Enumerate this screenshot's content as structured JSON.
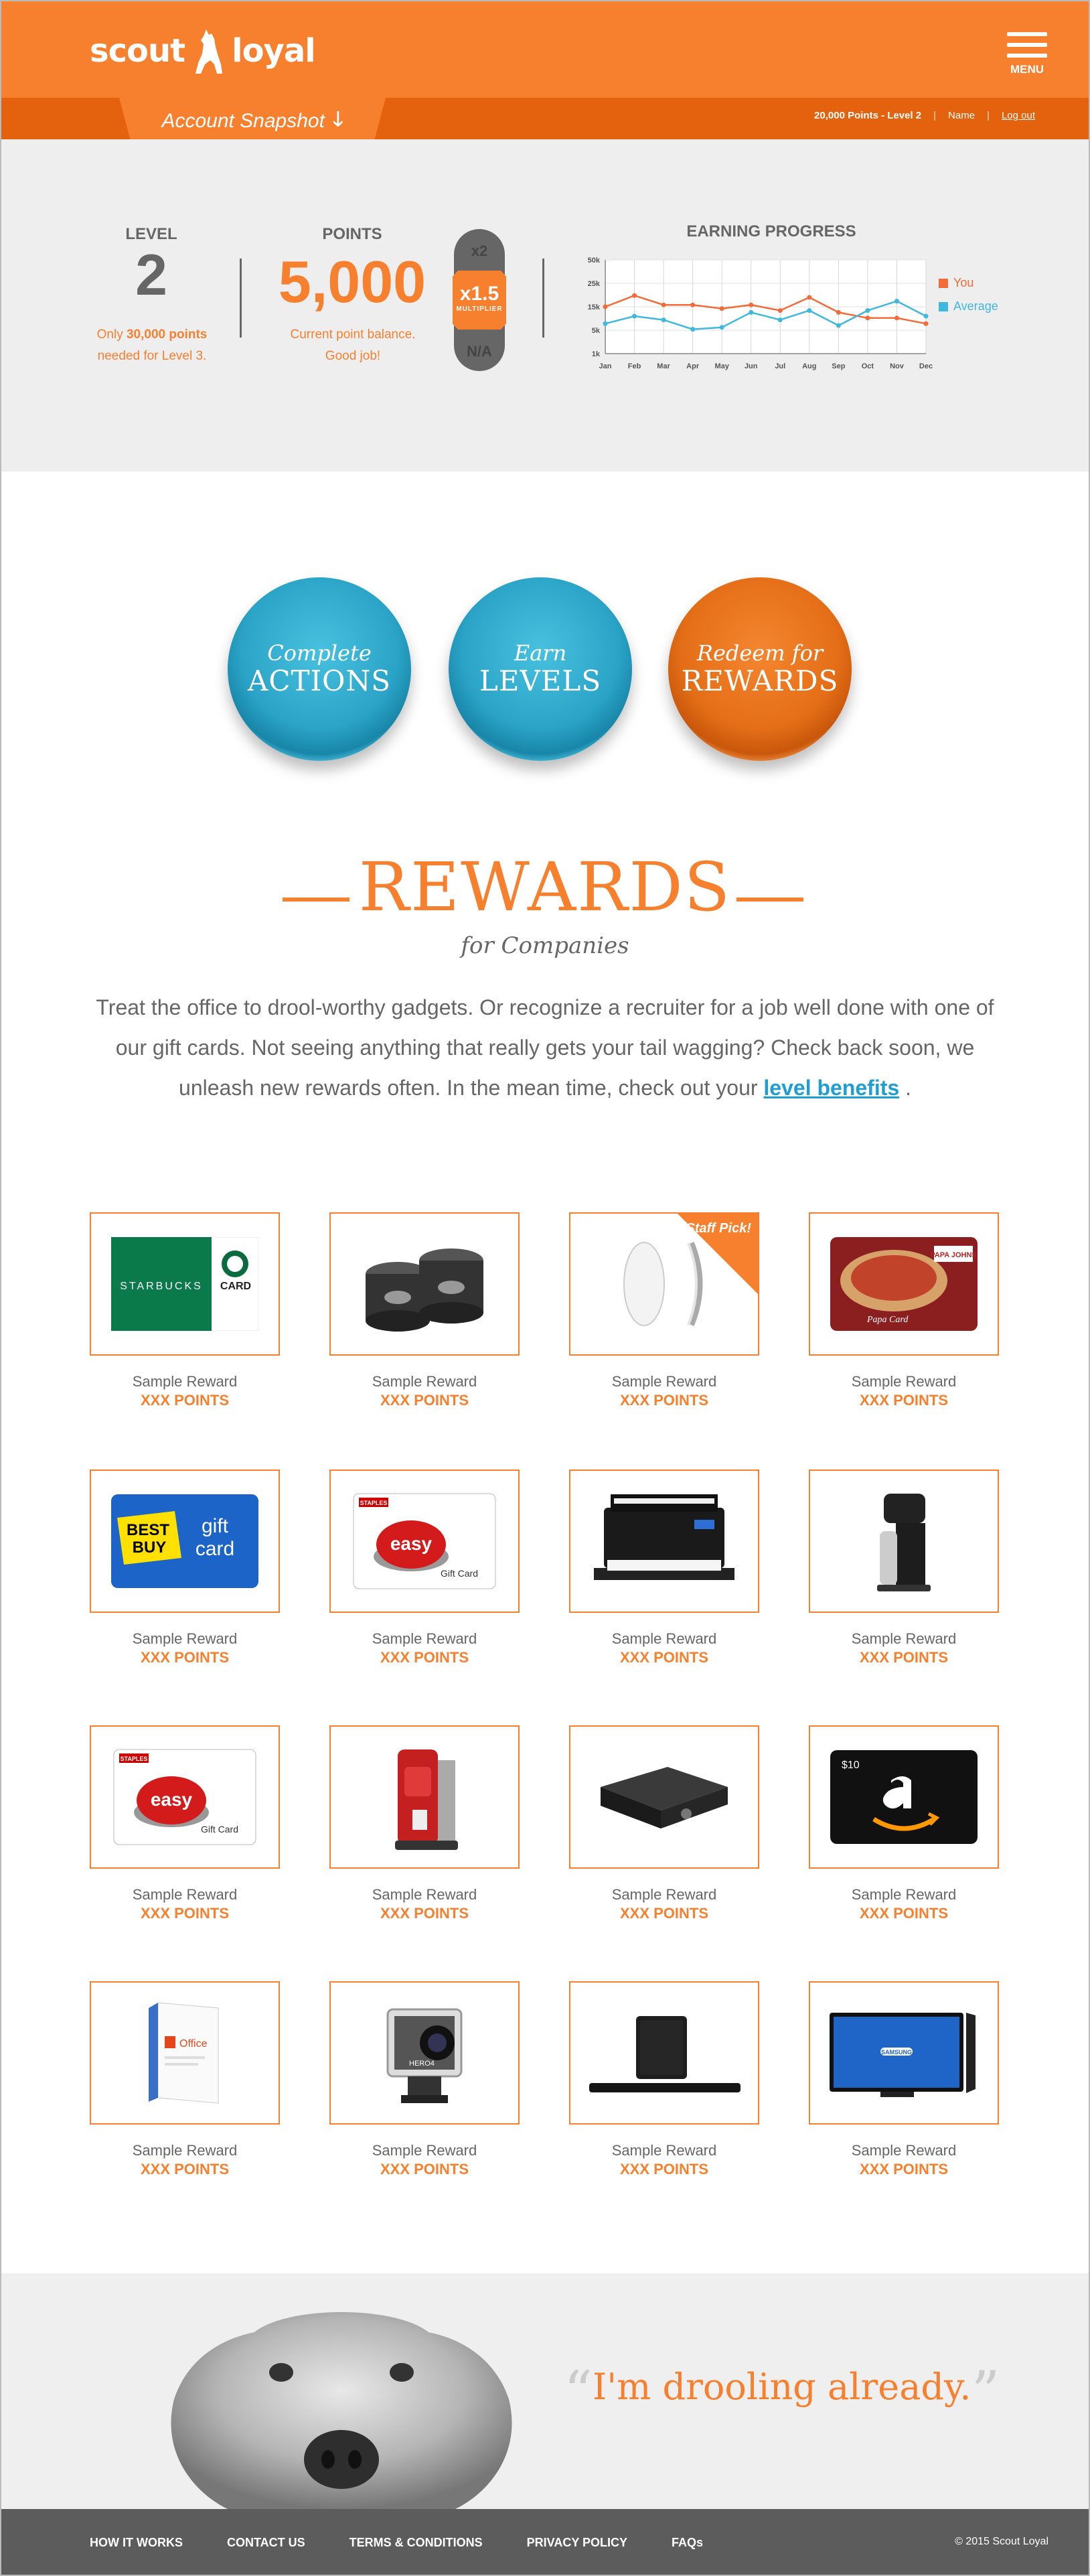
{
  "header": {
    "logo_left": "scout",
    "logo_right": "loyal",
    "menu_label": "MENU",
    "snapshot_label": "Account Snapshot",
    "snapshot_arrow": "🡓",
    "points_level": "20,000 Points - Level 2",
    "sep": "|",
    "name": "Name",
    "logout": "Log out"
  },
  "stats": {
    "level_label": "LEVEL",
    "level_value": "2",
    "level_note_pre": "Only ",
    "level_note_bold": "30,000 points",
    "level_note_post": "needed for Level 3.",
    "points_label": "POINTS",
    "points_value": "5,000",
    "points_note_1": "Current point balance.",
    "points_note_2": "Good job!",
    "mult_top": "x2",
    "mult_value": "x1.5",
    "mult_sub": "MULTIPLIER",
    "mult_bottom": "N/A",
    "chart_title": "EARNING PROGRESS",
    "legend_you": "You",
    "legend_avg": "Average"
  },
  "chart_data": {
    "type": "line",
    "title": "EARNING PROGRESS",
    "categories": [
      "Jan",
      "Feb",
      "Mar",
      "Apr",
      "May",
      "Jun",
      "Jul",
      "Aug",
      "Sep",
      "Oct",
      "Nov",
      "Dec"
    ],
    "y_ticks": [
      "50k",
      "25k",
      "15k",
      "5k",
      "1k"
    ],
    "ylim": [
      0,
      5
    ],
    "grid": true,
    "legend_position": "right",
    "series": [
      {
        "name": "You",
        "color": "#f26b38",
        "values": [
          2.5,
          3.1,
          2.6,
          2.6,
          2.4,
          2.6,
          2.3,
          3.0,
          2.2,
          1.9,
          1.9,
          1.6
        ]
      },
      {
        "name": "Average",
        "color": "#3fb8e0",
        "values": [
          1.6,
          2.0,
          1.8,
          1.3,
          1.4,
          2.2,
          1.8,
          2.3,
          1.5,
          2.3,
          2.8,
          2.0
        ]
      }
    ]
  },
  "actions": [
    {
      "top": "Complete",
      "big": "ACTIONS"
    },
    {
      "top": "Earn",
      "big": "LEVELS"
    },
    {
      "top": "Redeem for",
      "big": "REWARDS"
    }
  ],
  "rewards": {
    "title": "REWARDS",
    "subtitle": "for Companies",
    "desc": "Treat the office to drool-worthy gadgets. Or recognize a recruiter for a job well done with one of our gift cards. Not seeing anything that really gets your tail wagging? Check back soon, we unleash new rewards often. In the mean time, check out your ",
    "link": "level benefits",
    "desc_end": " ."
  },
  "items": [
    {
      "name": "Sample Reward",
      "points": "XXX POINTS",
      "kind": "starbucks"
    },
    {
      "name": "Sample Reward",
      "points": "XXX POINTS",
      "kind": "speakers"
    },
    {
      "name": "Sample Reward",
      "points": "XXX POINTS",
      "kind": "mouse",
      "staff": "Staff Pick!"
    },
    {
      "name": "Sample Reward",
      "points": "XXX POINTS",
      "kind": "papajohns"
    },
    {
      "name": "Sample Reward",
      "points": "XXX POINTS",
      "kind": "bestbuy"
    },
    {
      "name": "Sample Reward",
      "points": "XXX POINTS",
      "kind": "staples"
    },
    {
      "name": "Sample Reward",
      "points": "XXX POINTS",
      "kind": "printer"
    },
    {
      "name": "Sample Reward",
      "points": "XXX POINTS",
      "kind": "sodastream"
    },
    {
      "name": "Sample Reward",
      "points": "XXX POINTS",
      "kind": "staples"
    },
    {
      "name": "Sample Reward",
      "points": "XXX POINTS",
      "kind": "coffee"
    },
    {
      "name": "Sample Reward",
      "points": "XXX POINTS",
      "kind": "projector"
    },
    {
      "name": "Sample Reward",
      "points": "XXX POINTS",
      "kind": "amazon"
    },
    {
      "name": "Sample Reward",
      "points": "XXX POINTS",
      "kind": "office"
    },
    {
      "name": "Sample Reward",
      "points": "XXX POINTS",
      "kind": "gopro"
    },
    {
      "name": "Sample Reward",
      "points": "XXX POINTS",
      "kind": "soundbar"
    },
    {
      "name": "Sample Reward",
      "points": "XXX POINTS",
      "kind": "tv"
    }
  ],
  "image_text": {
    "starbucks": "STARBUCKS",
    "card": "CARD",
    "papa": "PAPA JOHNS",
    "papa_card": "Papa Card",
    "best": "BEST",
    "buy": "BUY",
    "gift": "gift",
    "card2": "card",
    "easy": "easy",
    "staples": "STAPLES",
    "giftcard": "Gift Card",
    "amazon_val": "$10",
    "office": "Office",
    "hero": "HERO4",
    "samsung": "SAMSUNG"
  },
  "quote": {
    "open": "“",
    "text": "I'm drooling already.",
    "close": "”"
  },
  "footer": {
    "links": [
      "HOW IT WORKS",
      "CONTACT US",
      "TERMS & CONDITIONS",
      "PRIVACY POLICY",
      "FAQs"
    ],
    "copyright": "© 2015 Scout Loyal"
  }
}
